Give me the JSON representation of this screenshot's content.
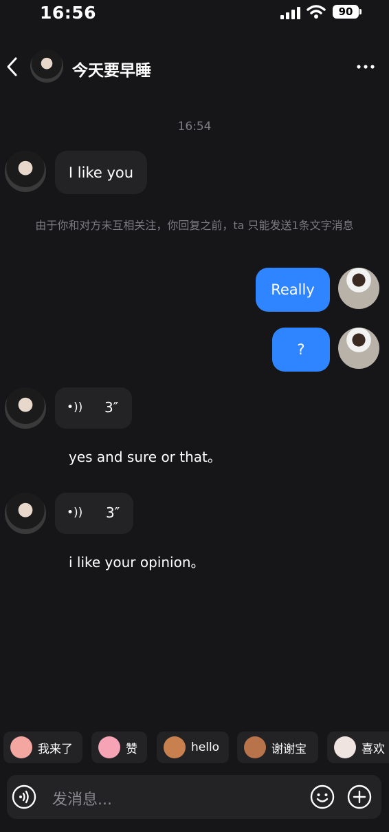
{
  "status_bar": {
    "time": "16:56",
    "battery": "90"
  },
  "header": {
    "title": "今天要早睡"
  },
  "chat": {
    "timestamp": "16:54",
    "incoming_text": "I like you",
    "notice": "由于你和对方未互相关注，你回复之前，ta 只能发送1条文字消息",
    "outgoing": [
      "Really",
      "?"
    ],
    "voice_messages": [
      {
        "icon": "•))",
        "duration": "3″",
        "transcript": "yes and sure or that。"
      },
      {
        "icon": "•))",
        "duration": "3″",
        "transcript": "i like your opinion。"
      }
    ]
  },
  "quick_replies": [
    {
      "label": "我来了",
      "sticker": "baby-sticker-icon",
      "color": "#f4a6a0"
    },
    {
      "label": "赞",
      "sticker": "pig-sticker-icon",
      "color": "#f6a3b6"
    },
    {
      "label": "hello",
      "sticker": "monkey-sticker-icon",
      "color": "#c8804e"
    },
    {
      "label": "谢谢宝",
      "sticker": "monkey-flower-sticker-icon",
      "color": "#b8734a"
    },
    {
      "label": "喜欢",
      "sticker": "sheep-sticker-icon",
      "color": "#f0e4e0"
    }
  ],
  "input": {
    "placeholder": "发消息..."
  },
  "colors": {
    "accent": "#2e85ff",
    "background": "#161618",
    "bubble": "#232326"
  }
}
